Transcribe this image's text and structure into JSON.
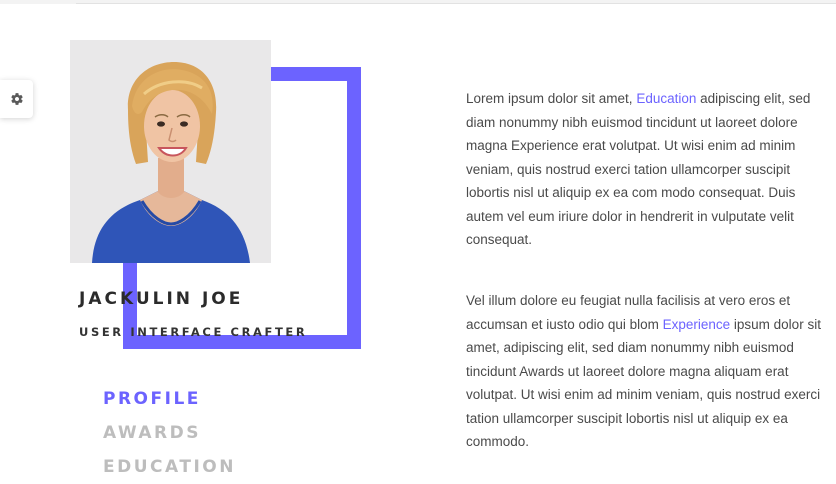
{
  "profile": {
    "name": "JACKULIN JOE",
    "title": "USER INTERFACE CRAFTER",
    "photo_alt": "Profile photo of a smiling woman with short blonde hair in a blue top"
  },
  "settings": {
    "icon": "gear-icon"
  },
  "nav": {
    "items": [
      {
        "label": "PROFILE",
        "active": true
      },
      {
        "label": "AWARDS",
        "active": false
      },
      {
        "label": "EDUCATION",
        "active": false
      }
    ]
  },
  "content": {
    "paragraph1": {
      "line1_before": "Lorem ipsum dolor sit amet, ",
      "line1_link": "Education",
      "line1_after": " adipiscing elit, sed",
      "lines": [
        "diam nonummy nibh euismod tincidunt ut laoreet dolore",
        "magna Experience erat volutpat. Ut wisi enim ad minim",
        "veniam, quis nostrud exerci tation ullamcorper suscipit",
        "lobortis nisl ut aliquip ex ea com modo consequat. Duis",
        "autem vel eum iriure dolor in hendrerit in vulputate velit",
        "consequat."
      ]
    },
    "paragraph2": {
      "line1": "Vel illum dolore eu feugiat nulla facilisis at vero eros et",
      "line2_before": "accumsan et iusto odio qui blom ",
      "line2_link": "Experience",
      "line2_after": " ipsum dolor sit",
      "lines": [
        "amet, adipiscing elit, sed diam nonummy nibh euismod",
        "tincidunt Awards ut laoreet dolore magna aliquam erat",
        "volutpat. Ut wisi enim ad minim veniam, quis nostrud exerci",
        "tation ullamcorper suscipit lobortis nisl ut aliquip ex ea",
        "commodo."
      ]
    }
  },
  "colors": {
    "accent": "#6c63ff",
    "nav_inactive": "#bdbdbd",
    "photo_bg": "#e9e8e9"
  }
}
